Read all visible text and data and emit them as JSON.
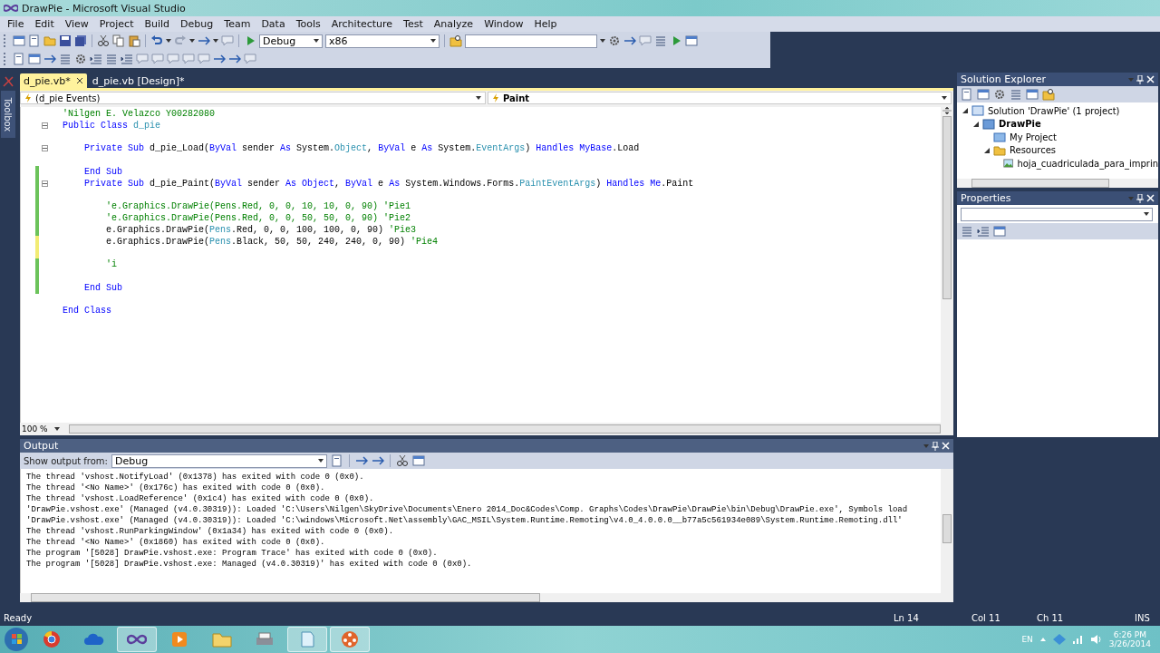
{
  "window": {
    "title": "DrawPie - Microsoft Visual Studio"
  },
  "menu": [
    "File",
    "Edit",
    "View",
    "Project",
    "Build",
    "Debug",
    "Team",
    "Data",
    "Tools",
    "Architecture",
    "Test",
    "Analyze",
    "Window",
    "Help"
  ],
  "toolbar": {
    "configuration": "Debug",
    "platform": "x86"
  },
  "toolbox": {
    "label": "Toolbox"
  },
  "document_tabs": [
    {
      "label": "d_pie.vb*",
      "selected": true
    },
    {
      "label": "d_pie.vb [Design]*",
      "selected": false
    }
  ],
  "editor": {
    "class_dropdown": "(d_pie Events)",
    "method_dropdown": "Paint",
    "zoom": "100 %",
    "lines": [
      {
        "fold": false,
        "saved_change": false,
        "unsaved_change": false,
        "tokens": [
          {
            "kind": "comment",
            "text": "'Nilgen E. Velazco Y00282080"
          }
        ]
      },
      {
        "fold": true,
        "saved_change": false,
        "unsaved_change": false,
        "tokens": [
          {
            "kind": "keyword",
            "text": "Public Class "
          },
          {
            "kind": "type",
            "text": "d_pie"
          }
        ]
      },
      {
        "fold": false,
        "saved_change": false,
        "unsaved_change": false
      },
      {
        "fold": true,
        "saved_change": false,
        "unsaved_change": false,
        "tokens": [
          {
            "kind": "keyword",
            "text": "    Private Sub "
          },
          {
            "kind": "plain",
            "text": "d_pie_Load("
          },
          {
            "kind": "keyword",
            "text": "ByVal"
          },
          {
            "kind": "plain",
            "text": " sender "
          },
          {
            "kind": "keyword",
            "text": "As"
          },
          {
            "kind": "plain",
            "text": " System."
          },
          {
            "kind": "type",
            "text": "Object"
          },
          {
            "kind": "plain",
            "text": ", "
          },
          {
            "kind": "keyword",
            "text": "ByVal"
          },
          {
            "kind": "plain",
            "text": " e "
          },
          {
            "kind": "keyword",
            "text": "As"
          },
          {
            "kind": "plain",
            "text": " System."
          },
          {
            "kind": "type",
            "text": "EventArgs"
          },
          {
            "kind": "plain",
            "text": ") "
          },
          {
            "kind": "keyword",
            "text": "Handles MyBase"
          },
          {
            "kind": "plain",
            "text": ".Load"
          }
        ]
      },
      {
        "fold": false,
        "saved_change": false,
        "unsaved_change": false
      },
      {
        "fold": false,
        "saved_change": true,
        "unsaved_change": false,
        "tokens": [
          {
            "kind": "keyword",
            "text": "    End Sub"
          }
        ]
      },
      {
        "fold": true,
        "saved_change": true,
        "unsaved_change": false,
        "tokens": [
          {
            "kind": "keyword",
            "text": "    Private Sub "
          },
          {
            "kind": "plain",
            "text": "d_pie_Paint("
          },
          {
            "kind": "keyword",
            "text": "ByVal"
          },
          {
            "kind": "plain",
            "text": " sender "
          },
          {
            "kind": "keyword",
            "text": "As Object"
          },
          {
            "kind": "plain",
            "text": ", "
          },
          {
            "kind": "keyword",
            "text": "ByVal"
          },
          {
            "kind": "plain",
            "text": " e "
          },
          {
            "kind": "keyword",
            "text": "As"
          },
          {
            "kind": "plain",
            "text": " System.Windows.Forms."
          },
          {
            "kind": "type",
            "text": "PaintEventArgs"
          },
          {
            "kind": "plain",
            "text": ") "
          },
          {
            "kind": "keyword",
            "text": "Handles Me"
          },
          {
            "kind": "plain",
            "text": ".Paint"
          }
        ]
      },
      {
        "fold": false,
        "saved_change": true,
        "unsaved_change": false
      },
      {
        "fold": false,
        "saved_change": true,
        "unsaved_change": false,
        "tokens": [
          {
            "kind": "comment",
            "text": "        'e.Graphics.DrawPie(Pens.Red, 0, 0, 10, 10, 0, 90) 'Pie1"
          }
        ]
      },
      {
        "fold": false,
        "saved_change": true,
        "unsaved_change": false,
        "tokens": [
          {
            "kind": "comment",
            "text": "        'e.Graphics.DrawPie(Pens.Red, 0, 0, 50, 50, 0, 90) 'Pie2"
          }
        ]
      },
      {
        "fold": false,
        "saved_change": true,
        "unsaved_change": false,
        "tokens": [
          {
            "kind": "plain",
            "text": "        e.Graphics.DrawPie("
          },
          {
            "kind": "type",
            "text": "Pens"
          },
          {
            "kind": "plain",
            "text": ".Red, 0, 0, 100, 100, 0, 90) "
          },
          {
            "kind": "comment",
            "text": "'Pie3"
          }
        ]
      },
      {
        "fold": false,
        "saved_change": false,
        "unsaved_change": true,
        "tokens": [
          {
            "kind": "plain",
            "text": "        e.Graphics.DrawPie("
          },
          {
            "kind": "type",
            "text": "Pens"
          },
          {
            "kind": "plain",
            "text": ".Black, 50, 50, 240, 240, 0, 90) "
          },
          {
            "kind": "comment",
            "text": "'Pie4"
          }
        ]
      },
      {
        "fold": false,
        "saved_change": false,
        "unsaved_change": true
      },
      {
        "fold": false,
        "saved_change": true,
        "unsaved_change": false,
        "tokens": [
          {
            "kind": "comment",
            "text": "        'i"
          }
        ]
      },
      {
        "fold": false,
        "saved_change": true,
        "unsaved_change": false
      },
      {
        "fold": false,
        "saved_change": true,
        "unsaved_change": false,
        "tokens": [
          {
            "kind": "keyword",
            "text": "    End Sub"
          }
        ]
      },
      {
        "fold": false,
        "saved_change": false,
        "unsaved_change": false
      },
      {
        "fold": false,
        "saved_change": false,
        "unsaved_change": false,
        "tokens": [
          {
            "kind": "keyword",
            "text": "End Class"
          }
        ]
      }
    ]
  },
  "solution_explorer": {
    "title": "Solution Explorer",
    "tree": [
      {
        "label": "Solution 'DrawPie' (1 project)",
        "kind": "solution",
        "expanded": true,
        "children": [
          {
            "label": "DrawPie",
            "kind": "project",
            "expanded": true,
            "children": [
              {
                "label": "My Project",
                "kind": "settings"
              },
              {
                "label": "Resources",
                "kind": "folder",
                "expanded": true,
                "children": [
                  {
                    "label": "hoja_cuadriculada_para_imprin",
                    "kind": "image"
                  }
                ]
              }
            ]
          }
        ]
      }
    ]
  },
  "properties": {
    "title": "Properties"
  },
  "output": {
    "title": "Output",
    "source_label": "Show output from:",
    "source": "Debug",
    "lines": [
      "The thread 'vshost.NotifyLoad' (0x1378) has exited with code 0 (0x0).",
      "The thread '<No Name>' (0x176c) has exited with code 0 (0x0).",
      "The thread 'vshost.LoadReference' (0x1c4) has exited with code 0 (0x0).",
      "'DrawPie.vshost.exe' (Managed (v4.0.30319)): Loaded 'C:\\Users\\Nilgen\\SkyDrive\\Documents\\Enero 2014_Doc&Codes\\Comp. Graphs\\Codes\\DrawPie\\DrawPie\\bin\\Debug\\DrawPie.exe', Symbols load",
      "'DrawPie.vshost.exe' (Managed (v4.0.30319)): Loaded 'C:\\windows\\Microsoft.Net\\assembly\\GAC_MSIL\\System.Runtime.Remoting\\v4.0_4.0.0.0__b77a5c561934e089\\System.Runtime.Remoting.dll'",
      "The thread 'vshost.RunParkingWindow' (0x1a34) has exited with code 0 (0x0).",
      "The thread '<No Name>' (0x1860) has exited with code 0 (0x0).",
      "The program '[5028] DrawPie.vshost.exe: Program Trace' has exited with code 0 (0x0).",
      "The program '[5028] DrawPie.vshost.exe: Managed (v4.0.30319)' has exited with code 0 (0x0)."
    ]
  },
  "status_bar": {
    "message": "Ready",
    "line": "Ln 14",
    "column": "Col 11",
    "char": "Ch 11",
    "mode": "INS"
  },
  "taskbar": {
    "language": "EN",
    "time": "6:26 PM",
    "date": "3/26/2014"
  }
}
